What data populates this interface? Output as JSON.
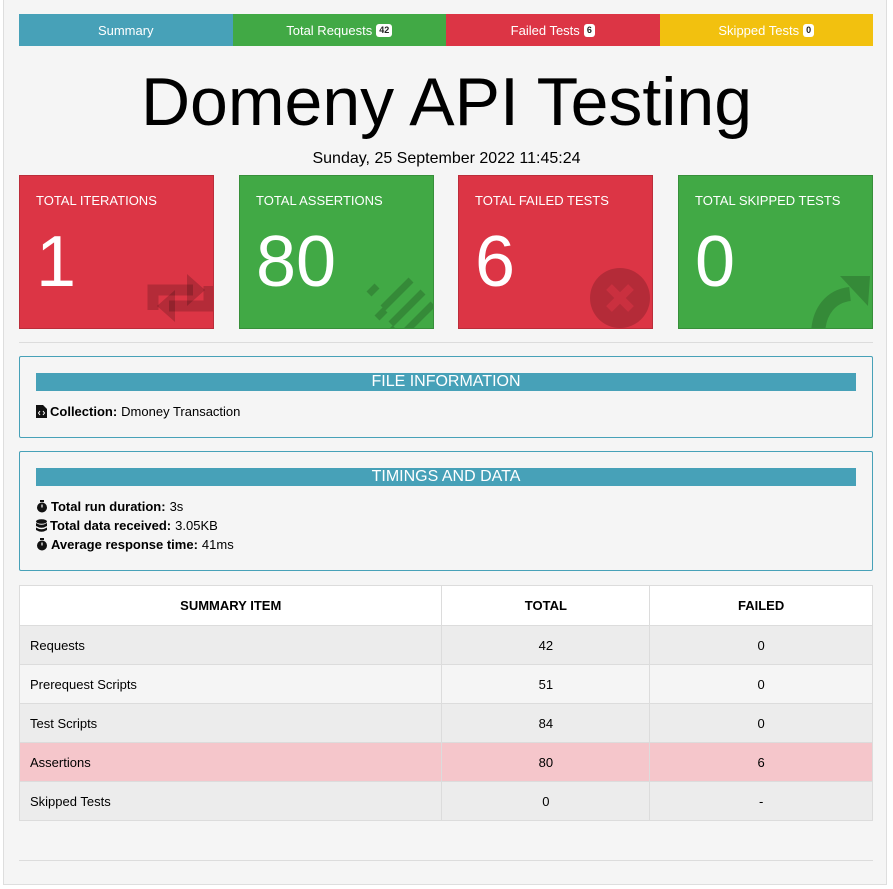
{
  "tabs": [
    {
      "label": "Summary",
      "badge": ""
    },
    {
      "label": "Total Requests",
      "badge": "42"
    },
    {
      "label": "Failed Tests",
      "badge": "6"
    },
    {
      "label": "Skipped Tests",
      "badge": "0"
    }
  ],
  "title": "Domeny API Testing",
  "date": "Sunday, 25 September 2022 11:45:24",
  "cards": [
    {
      "label": "TOTAL ITERATIONS",
      "value": "1",
      "icon": "repeat-icon",
      "color": "#dc3545"
    },
    {
      "label": "TOTAL ASSERTIONS",
      "value": "80",
      "icon": "list-icon",
      "color": "#41a945"
    },
    {
      "label": "TOTAL FAILED TESTS",
      "value": "6",
      "icon": "times-circle-icon",
      "color": "#dc3545"
    },
    {
      "label": "TOTAL SKIPPED TESTS",
      "value": "0",
      "icon": "share-arrow-icon",
      "color": "#41a945"
    }
  ],
  "file_info": {
    "heading": "FILE INFORMATION",
    "collection_label": "Collection:",
    "collection_value": "Dmoney Transaction"
  },
  "timings": {
    "heading": "TIMINGS AND DATA",
    "duration_label": "Total run duration:",
    "duration_value": "3s",
    "data_label": "Total data received:",
    "data_value": "3.05KB",
    "response_label": "Average response time:",
    "response_value": "41ms"
  },
  "summary_table": {
    "headers": [
      "SUMMARY ITEM",
      "TOTAL",
      "FAILED"
    ],
    "rows": [
      [
        "Requests",
        "42",
        "0"
      ],
      [
        "Prerequest Scripts",
        "51",
        "0"
      ],
      [
        "Test Scripts",
        "84",
        "0"
      ],
      [
        "Assertions",
        "80",
        "6"
      ],
      [
        "Skipped Tests",
        "0",
        "-"
      ]
    ]
  }
}
